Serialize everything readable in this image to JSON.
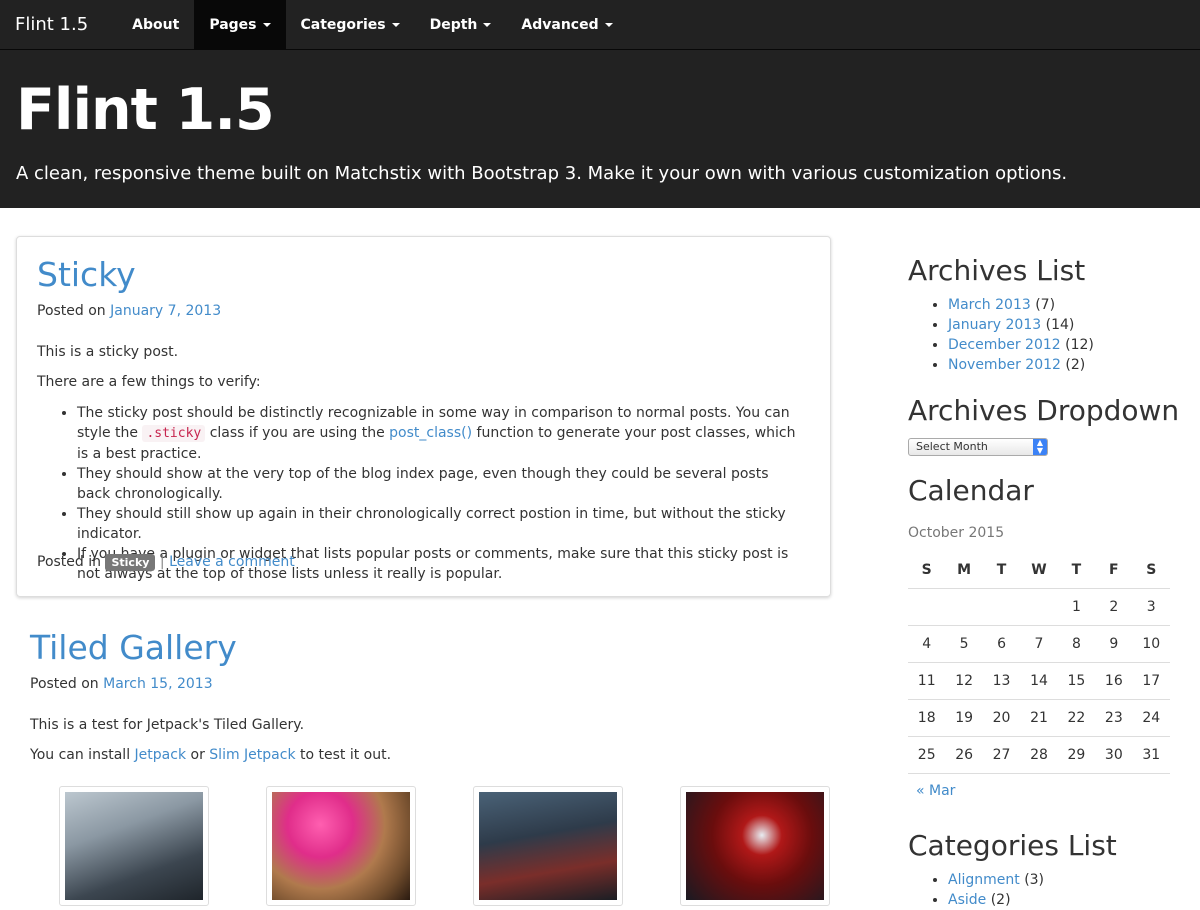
{
  "nav": {
    "brand": "Flint 1.5",
    "items": [
      {
        "label": "About"
      },
      {
        "label": "Pages"
      },
      {
        "label": "Categories"
      },
      {
        "label": "Depth"
      },
      {
        "label": "Advanced"
      }
    ]
  },
  "header": {
    "title": "Flint 1.5",
    "description": "A clean, responsive theme built on Matchstix with Bootstrap 3. Make it your own with various customization options."
  },
  "sticky_post": {
    "title": "Sticky",
    "posted_on_label": "Posted on",
    "date": "January 7, 2013",
    "para1": "This is a sticky post.",
    "para2": "There are a few things to verify:",
    "bullet1_a": "The sticky post should be distinctly recognizable in some way in comparison to normal posts. You can style the",
    "bullet1_code": ".sticky",
    "bullet1_b": "class if you are using the",
    "bullet1_link": "post_class()",
    "bullet1_c": "function to generate your post classes, which is a best practice.",
    "bullet2": "They should show at the very top of the blog index page, even though they could be several posts back chronologically.",
    "bullet3": "They should still show up again in their chronologically correct postion in time, but without the sticky indicator.",
    "bullet4": "If you have a plugin or widget that lists popular posts or comments, make sure that this sticky post is not always at the top of those lists unless it really is popular.",
    "posted_in_label": "Posted in",
    "category_badge": "Sticky",
    "separator": "|",
    "comment_link": "Leave a comment"
  },
  "gallery_post": {
    "title": "Tiled Gallery",
    "posted_on_label": "Posted on",
    "date": "March 15, 2013",
    "para1": "This is a test for Jetpack's Tiled Gallery.",
    "para2_a": "You can install",
    "link_jetpack": "Jetpack",
    "para2_or": "or",
    "link_slim": "Slim Jetpack",
    "para2_b": "to test it out."
  },
  "sidebar": {
    "archives_title": "Archives List",
    "archives": [
      {
        "month": "March 2013",
        "count": "(7)"
      },
      {
        "month": "January 2013",
        "count": "(14)"
      },
      {
        "month": "December 2012",
        "count": "(12)"
      },
      {
        "month": "November 2012",
        "count": "(2)"
      }
    ],
    "dropdown_title": "Archives Dropdown",
    "dropdown_value": "Select Month",
    "calendar_title": "Calendar",
    "calendar_caption": "October 2015",
    "calendar_days": [
      "S",
      "M",
      "T",
      "W",
      "T",
      "F",
      "S"
    ],
    "calendar_weeks": [
      [
        "",
        "",
        "",
        "",
        "1",
        "2",
        "3"
      ],
      [
        "4",
        "5",
        "6",
        "7",
        "8",
        "9",
        "10"
      ],
      [
        "11",
        "12",
        "13",
        "14",
        "15",
        "16",
        "17"
      ],
      [
        "18",
        "19",
        "20",
        "21",
        "22",
        "23",
        "24"
      ],
      [
        "25",
        "26",
        "27",
        "28",
        "29",
        "30",
        "31"
      ]
    ],
    "calendar_prev": "« Mar",
    "categories_title": "Categories List",
    "categories": [
      {
        "name": "Alignment",
        "count": "(3)"
      },
      {
        "name": "Aside",
        "count": "(2)"
      }
    ]
  },
  "colors": {
    "navbar_bg": "#222222",
    "link": "#428bca",
    "code": "#c7254e"
  }
}
